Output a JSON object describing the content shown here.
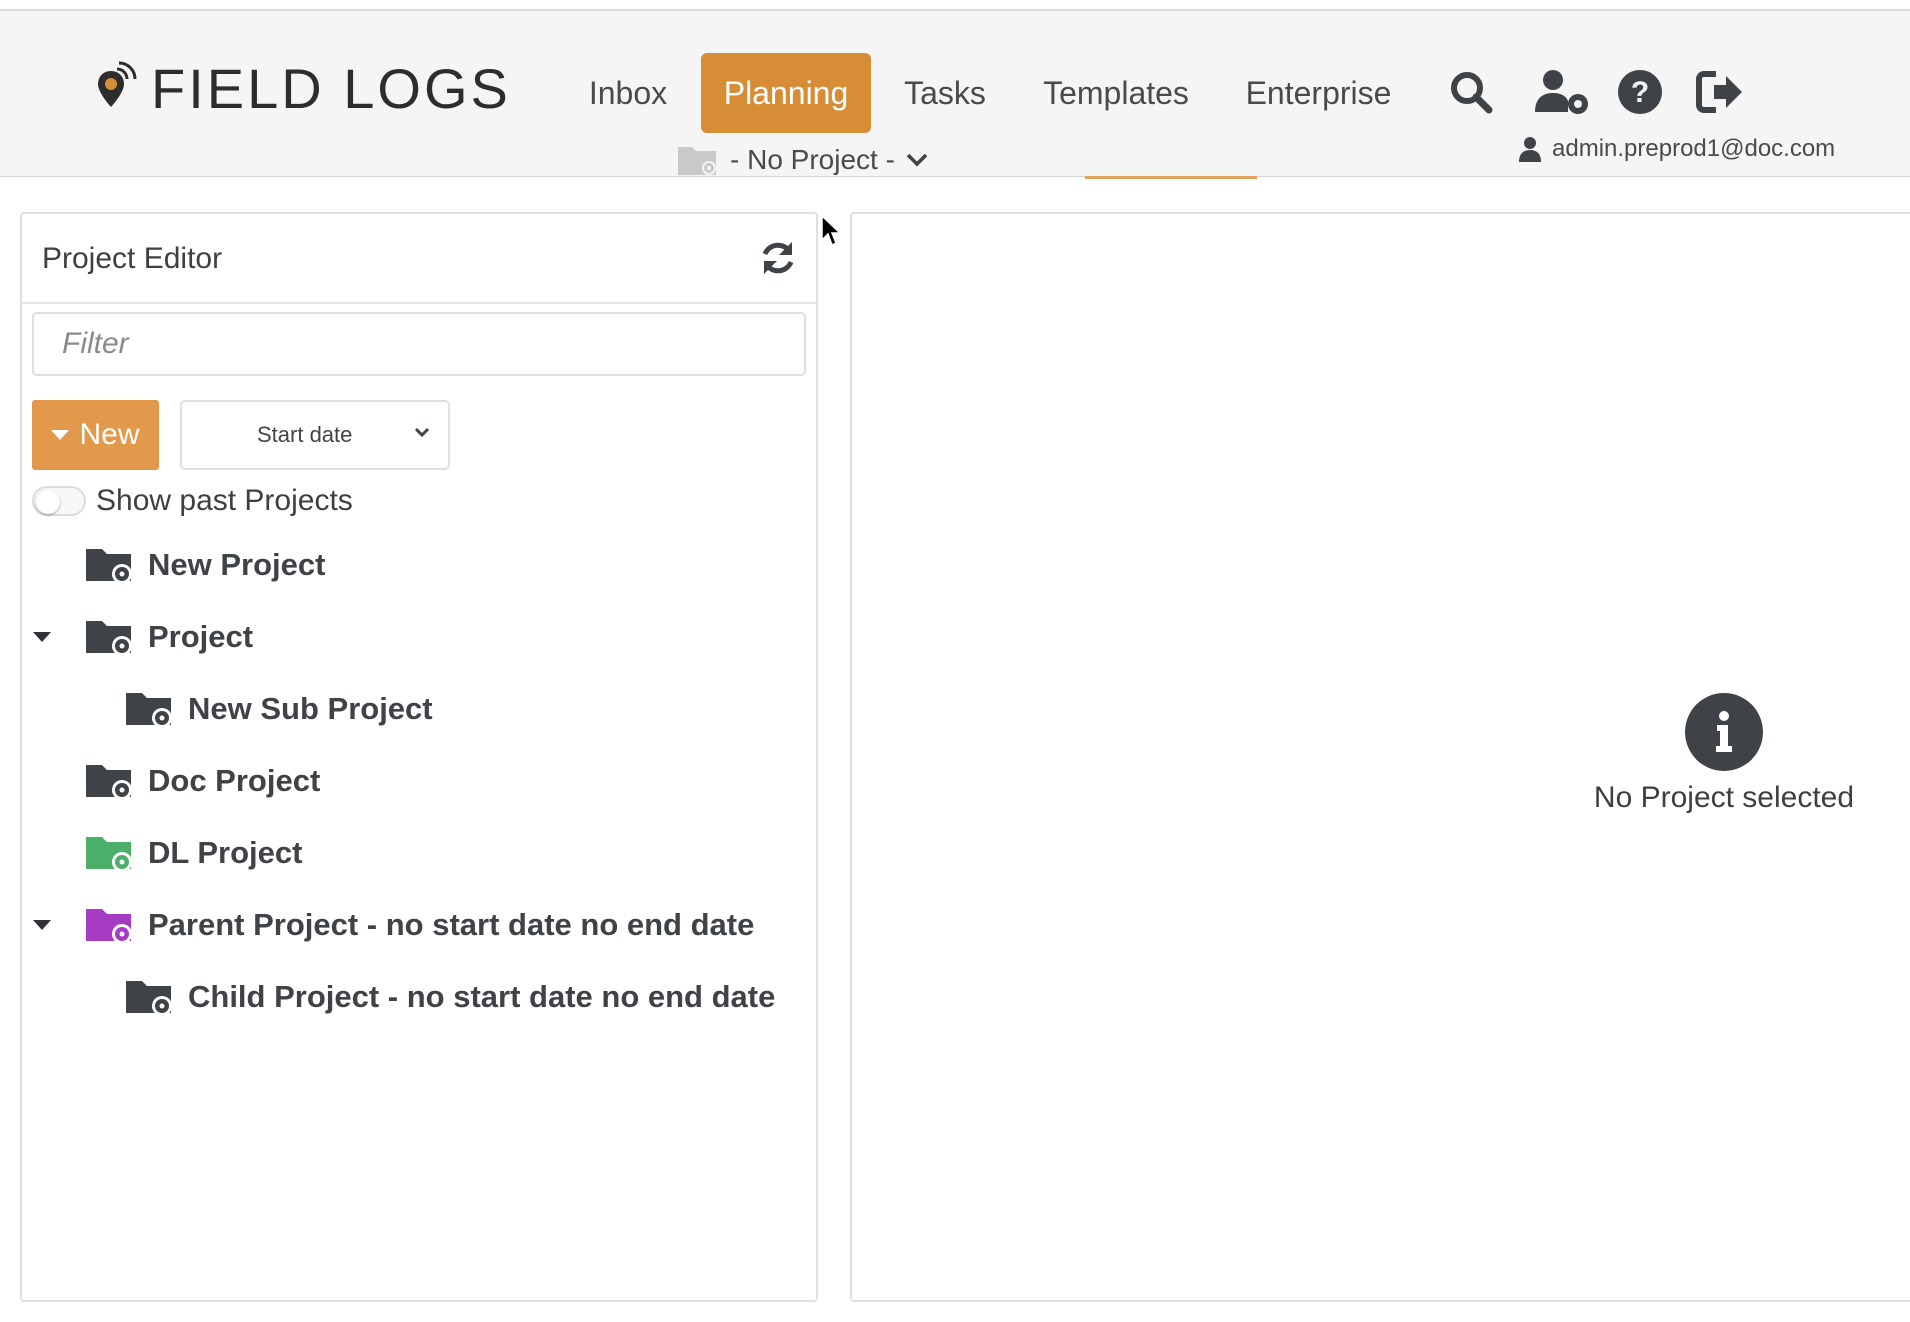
{
  "brand": {
    "name": "FIELD LOGS",
    "accent": "#d68d35"
  },
  "nav": {
    "items": [
      {
        "label": "Inbox",
        "active": false
      },
      {
        "label": "Planning",
        "active": true
      },
      {
        "label": "Tasks",
        "active": false
      },
      {
        "label": "Templates",
        "active": false
      },
      {
        "label": "Enterprise",
        "active": false
      }
    ],
    "project_selector": "- No Project -",
    "icons": [
      "search-icon",
      "user-settings-icon",
      "help-icon",
      "logout-icon"
    ]
  },
  "user": {
    "email": "admin.preprod1@doc.com"
  },
  "project_editor": {
    "title": "Project Editor",
    "filter_placeholder": "Filter",
    "filter_value": "",
    "new_label": "New",
    "sort_value": "Start date",
    "show_past_label": "Show past Projects",
    "show_past_on": false,
    "tree": [
      {
        "label": "New Project",
        "color": "#3f4347",
        "level": 0,
        "expandable": false
      },
      {
        "label": "Project",
        "color": "#3f4347",
        "level": 0,
        "expandable": true
      },
      {
        "label": "New Sub Project",
        "color": "#3f4347",
        "level": 1,
        "expandable": false
      },
      {
        "label": "Doc Project",
        "color": "#3f4347",
        "level": 0,
        "expandable": false
      },
      {
        "label": "DL Project",
        "color": "#4caf6a",
        "level": 0,
        "expandable": false
      },
      {
        "label": "Parent Project - no start date no end date",
        "color": "#a63cc4",
        "level": 0,
        "expandable": true
      },
      {
        "label": "Child Project - no start date no end date",
        "color": "#3f4347",
        "level": 1,
        "expandable": false
      }
    ]
  },
  "detail": {
    "empty_message": "No Project selected"
  }
}
